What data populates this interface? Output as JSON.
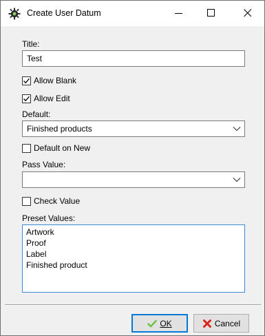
{
  "window": {
    "title": "Create User Datum",
    "icons": {
      "app": "gear-app-icon",
      "minimize": "minimize-icon",
      "maximize": "maximize-icon",
      "close": "close-icon"
    }
  },
  "form": {
    "title_label": "Title:",
    "title_value": "Test",
    "allow_blank": {
      "label": "Allow Blank",
      "checked": true
    },
    "allow_edit": {
      "label": "Allow Edit",
      "checked": true
    },
    "default_label": "Default:",
    "default_value": "Finished products",
    "default_on_new": {
      "label": "Default on New",
      "checked": false
    },
    "pass_value_label": "Pass Value:",
    "pass_value": "",
    "check_value": {
      "label": "Check Value",
      "checked": false
    },
    "preset_values_label": "Preset Values:",
    "preset_values": [
      "Artwork",
      "Proof",
      "Label",
      "Finished product"
    ]
  },
  "buttons": {
    "ok_label": "OK",
    "cancel_label": "Cancel",
    "ok_icon": "checkmark-icon",
    "cancel_icon": "red-x-icon"
  },
  "colors": {
    "ok_check": "#6bbf3a",
    "cancel_x": "#d9261c",
    "focus_border": "#3a89d6"
  }
}
